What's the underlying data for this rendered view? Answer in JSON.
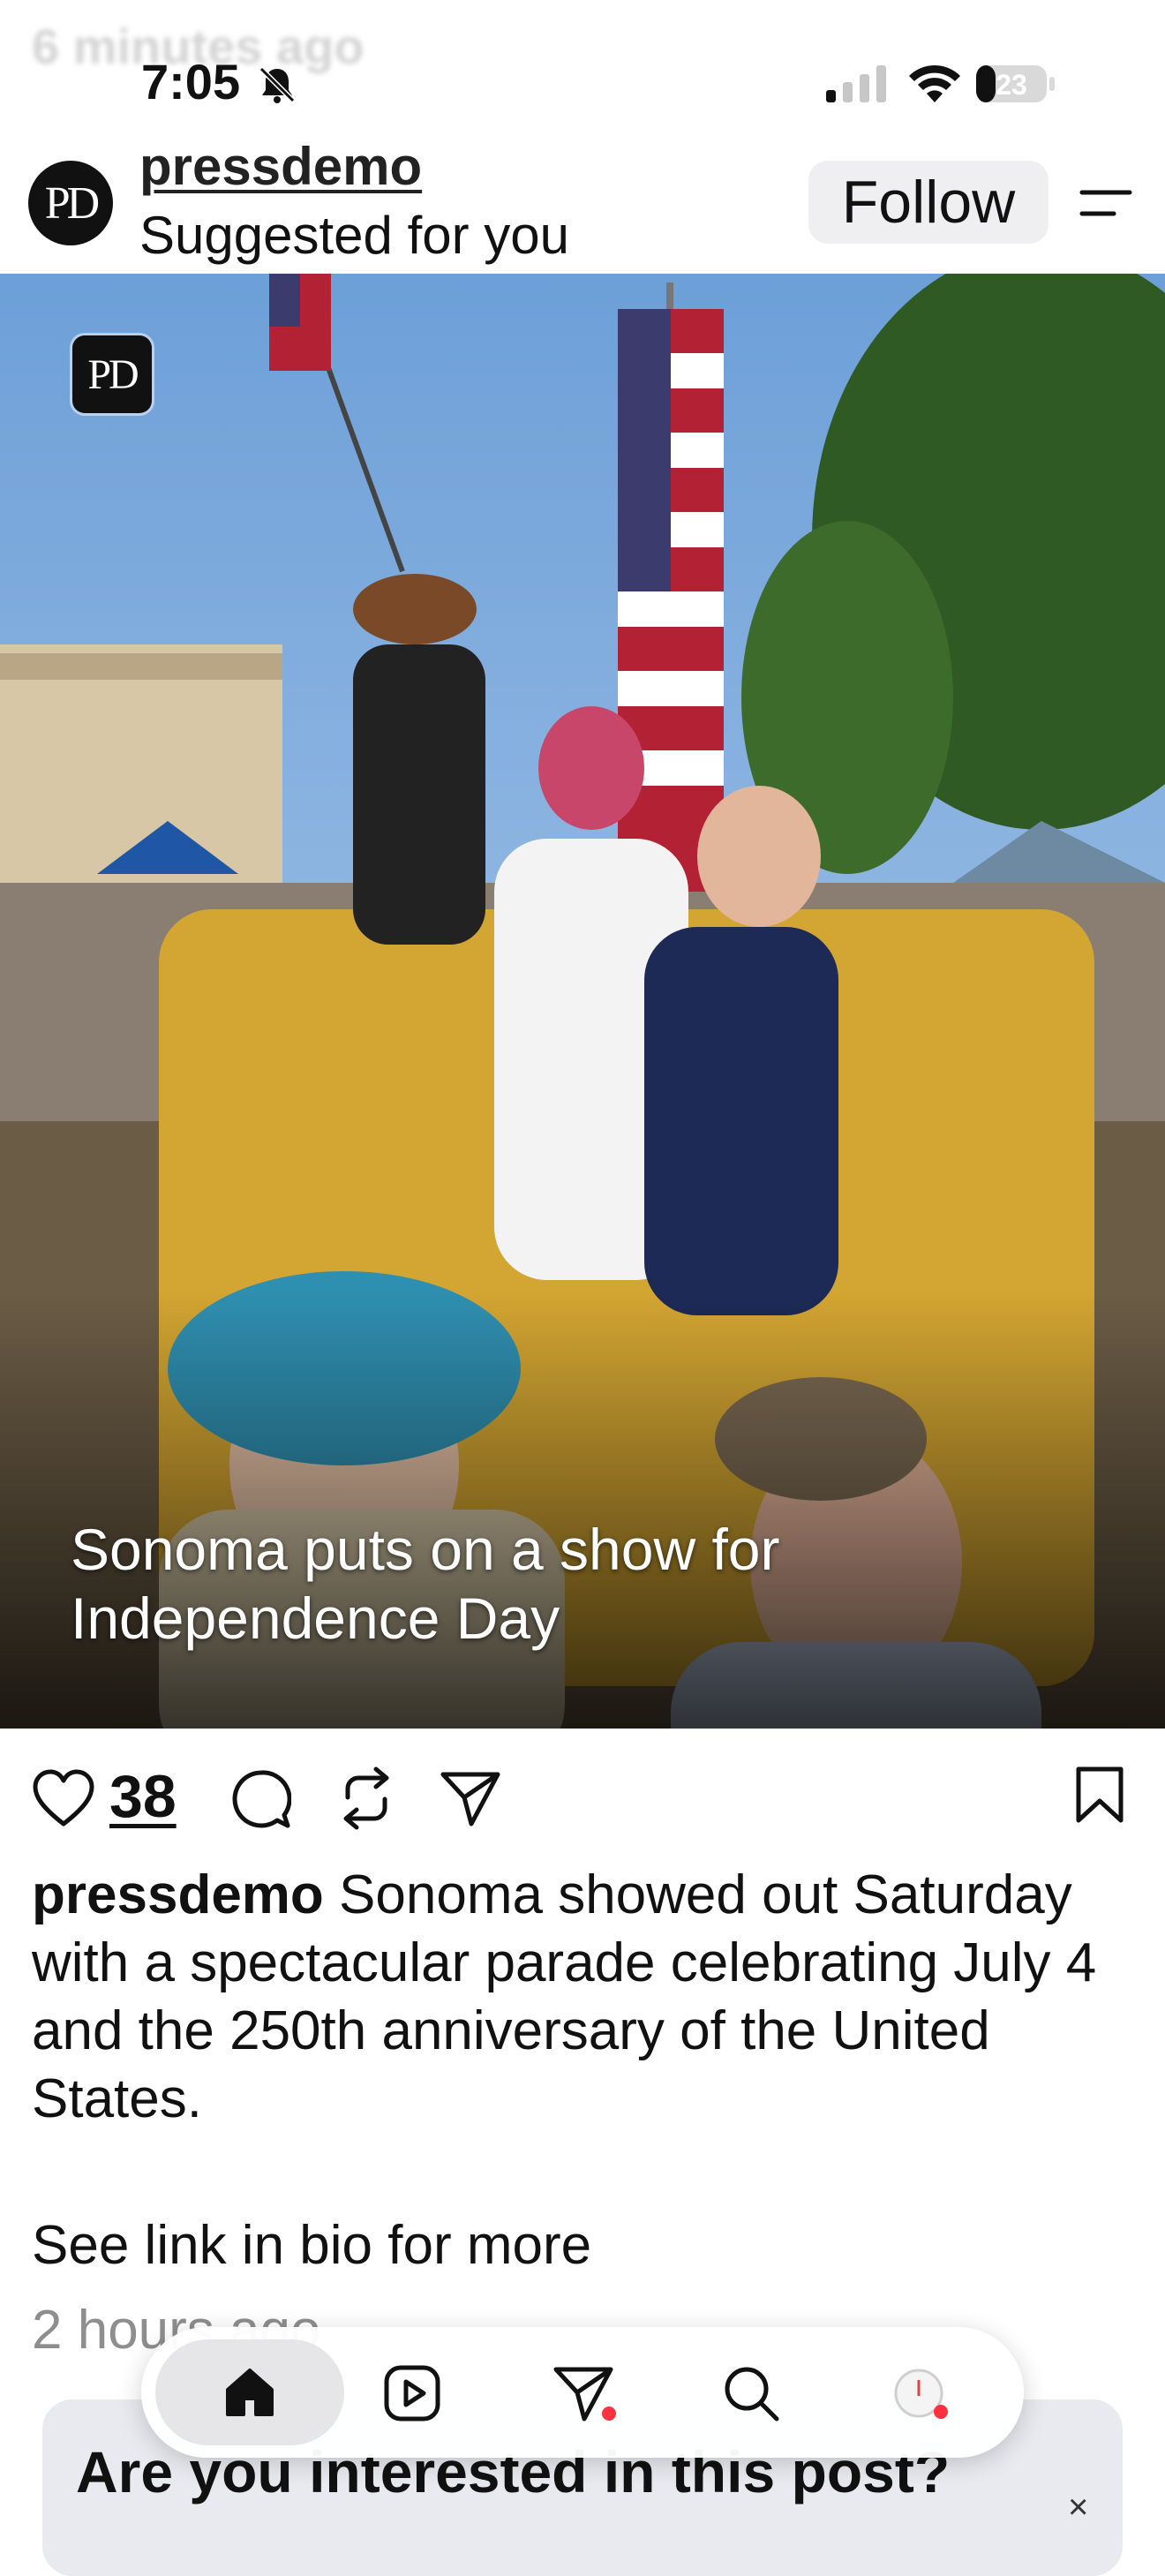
{
  "ghost_text": "6 minutes ago",
  "status_bar": {
    "time": "7:05",
    "battery": "23",
    "icons": [
      "bell-slash-icon",
      "signal-icon",
      "wifi-icon",
      "battery-icon"
    ]
  },
  "post": {
    "avatar_text": "PD",
    "username": "pressdemo",
    "subtitle": "Suggested for you",
    "follow_label": "Follow",
    "image_badge": "PD",
    "image_caption": "Sonoma puts on a show for Independence Day",
    "likes": "38",
    "caption_user": "pressdemo",
    "caption_text": "Sonoma showed out Saturday with a spectacular parade celebrating July 4 and the 250th anniversary of the United States.",
    "see_link": "See link in bio for more",
    "time_ago": "2 hours ago"
  },
  "card": {
    "title": "Are you interested in this post?",
    "close": "×"
  },
  "tabbar": {
    "items": [
      "home-icon",
      "reels-icon",
      "messages-icon",
      "search-icon",
      "profile-icon"
    ]
  },
  "colors": {
    "accent_dot": "#ff3040",
    "follow_bg": "#efeff1",
    "card_bg": "#e8eaef"
  }
}
